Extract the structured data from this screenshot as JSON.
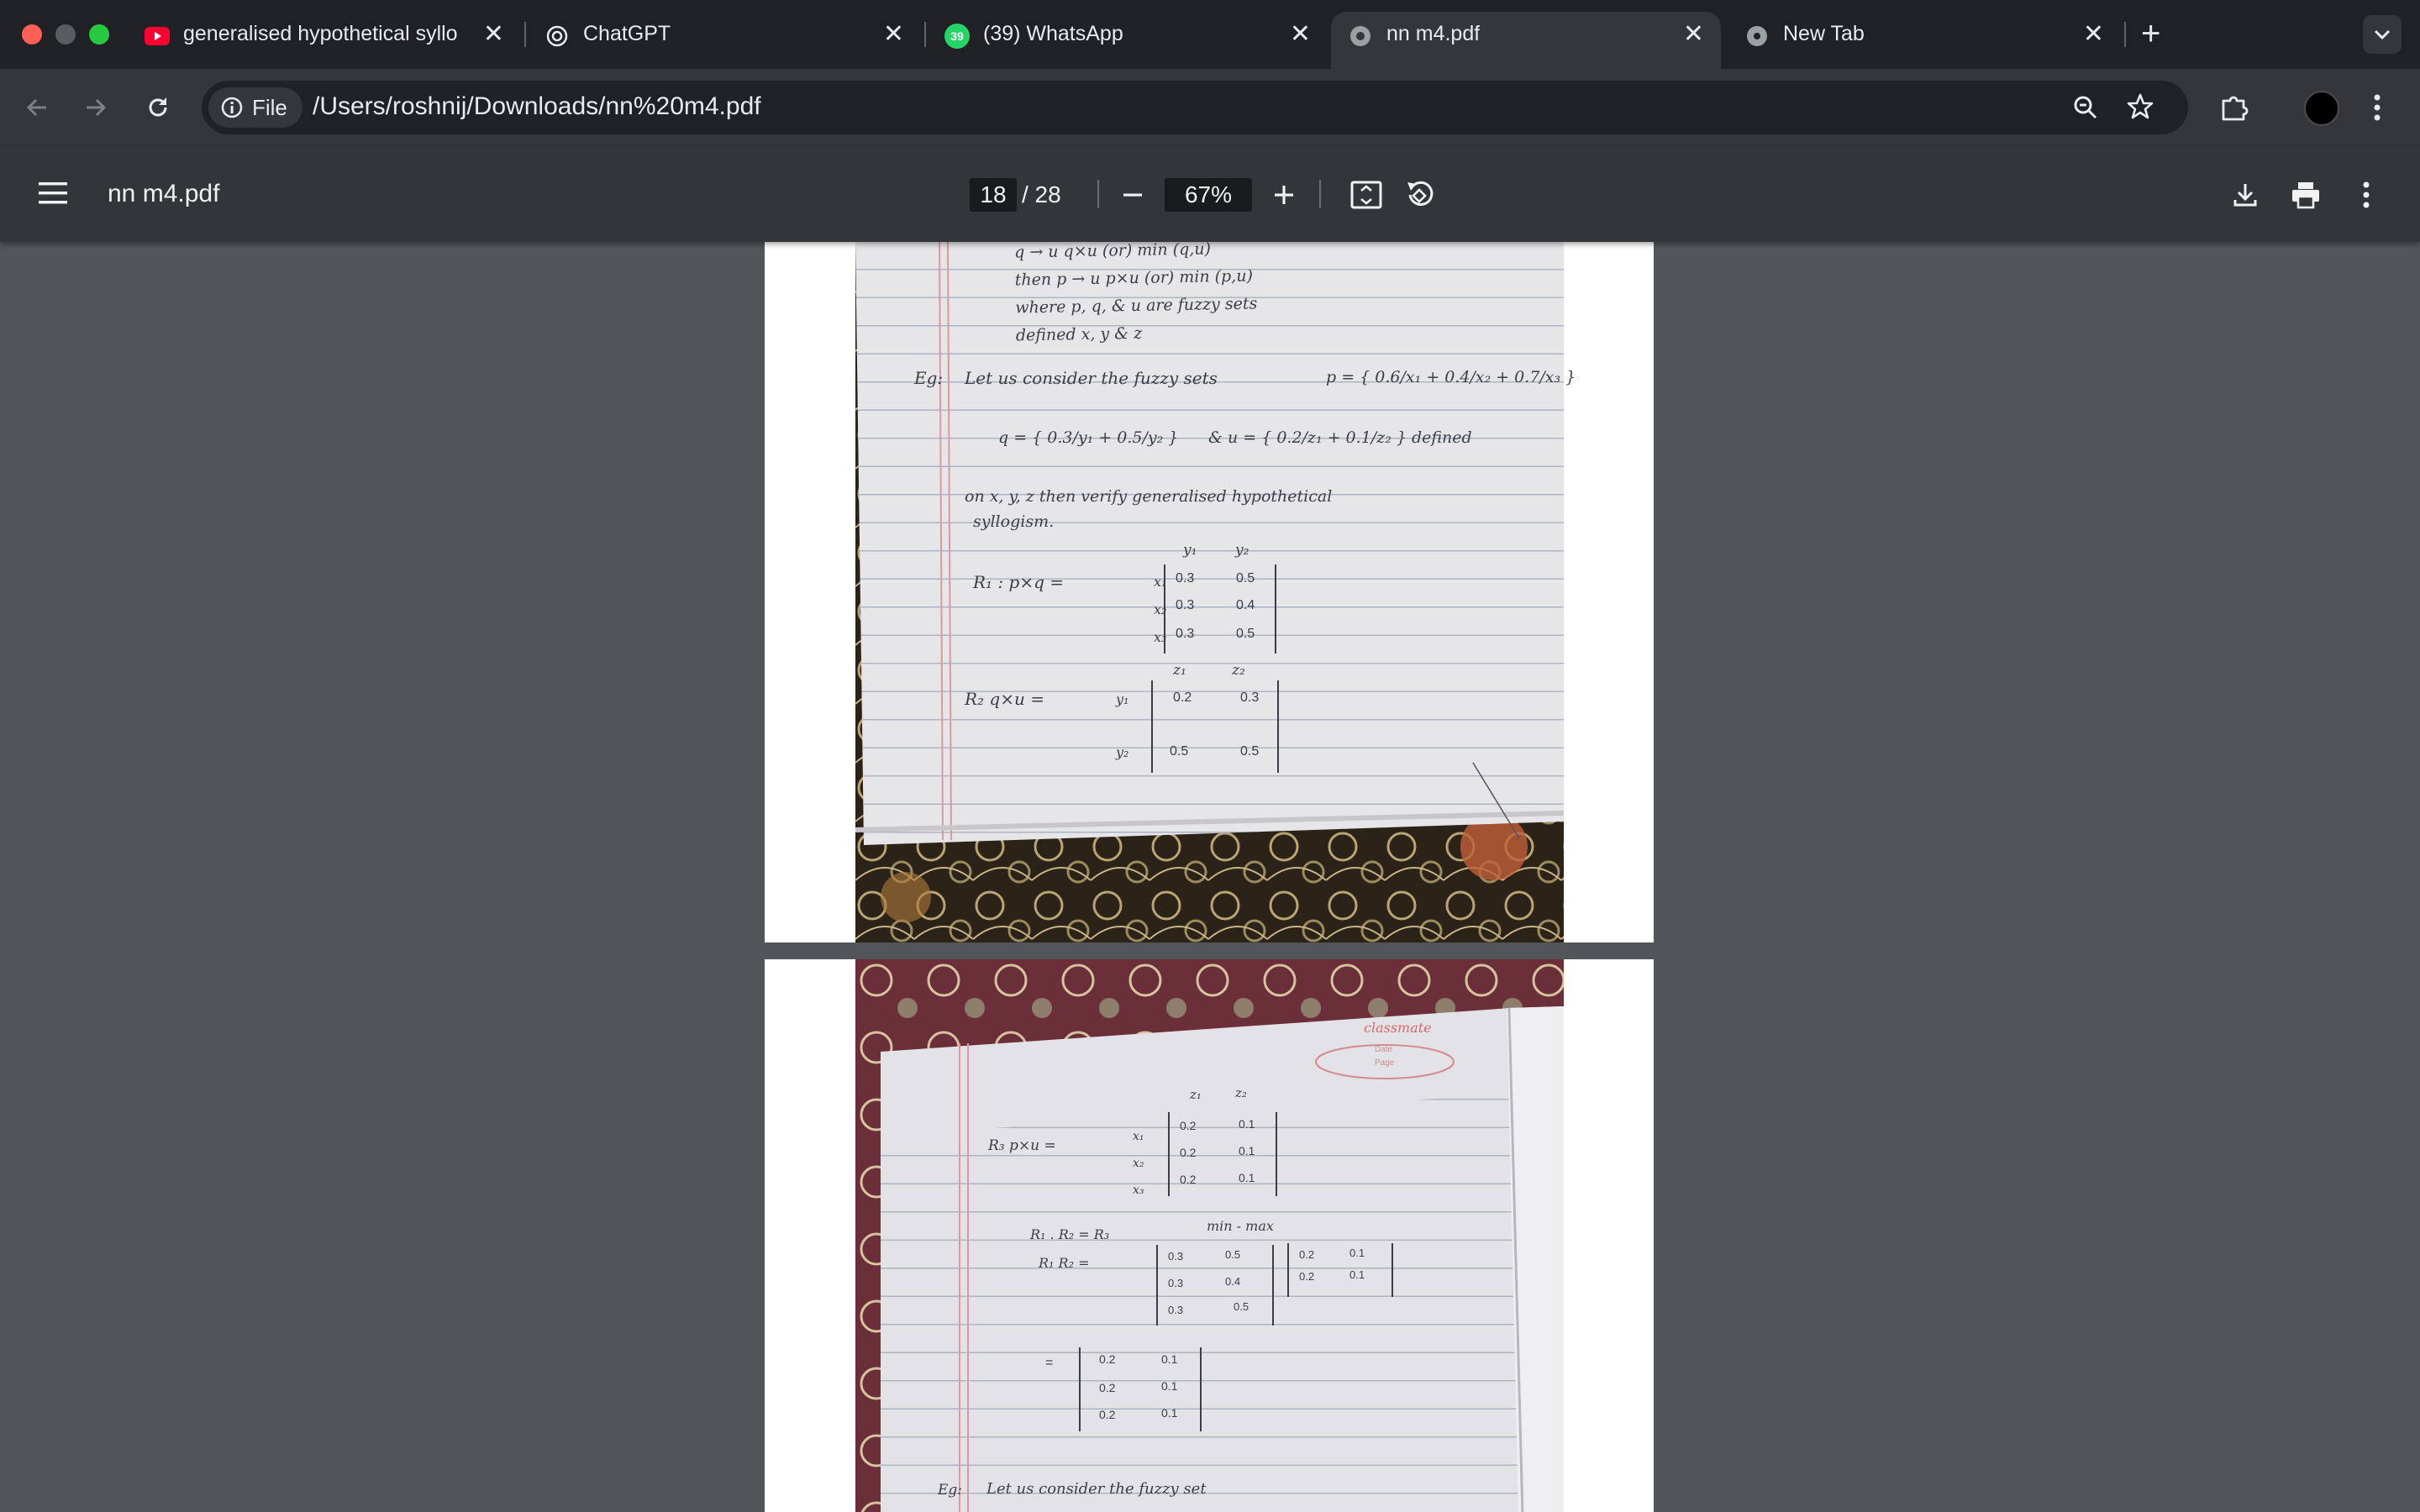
{
  "browser": {
    "tabs": [
      {
        "title": "generalised hypothetical syllo",
        "icon": "youtube-icon",
        "active": false
      },
      {
        "title": "ChatGPT",
        "icon": "chatgpt-icon",
        "active": false
      },
      {
        "title": "(39) WhatsApp",
        "icon": "whatsapp-icon",
        "badge": "39",
        "active": false
      },
      {
        "title": "nn m4.pdf",
        "icon": "globe-icon",
        "active": true
      },
      {
        "title": "New Tab",
        "icon": "chrome-icon",
        "active": false
      }
    ],
    "new_tab_label": "+",
    "address": {
      "chip_label": "File",
      "url": "/Users/roshnij/Downloads/nn%20m4.pdf"
    }
  },
  "pdf_viewer": {
    "title": "nn m4.pdf",
    "current_page": "18",
    "total_pages": "/ 28",
    "zoom": "67%"
  },
  "page_a_notes": {
    "lines": [
      "q → u  q×u (or) min (q,u)",
      "then p → u  p×u (or) min (p,u)",
      "where p, q, & u are fuzzy sets",
      "defined x, y & z"
    ],
    "example_intro": "Let us consider the fuzzy sets",
    "eg": "Eg:",
    "p_def": "p = { 0.6/x₁ + 0.4/x₂ + 0.7/x₃ }",
    "q_def": "q = { 0.3/y₁ + 0.5/y₂ }",
    "u_def": "& u = { 0.2/z₁ + 0.1/z₂ } defined",
    "verify": "on x, y, z then verify generalised hypothetical",
    "syllogism": "syllogism.",
    "r1_label": "R₁ : p×q =",
    "r2_label": "R₂  q×u =",
    "r1_cols": [
      "y₁",
      "y₂"
    ],
    "r1_rows": [
      {
        "label": "x₁",
        "cells": [
          "0.3",
          "0.5"
        ]
      },
      {
        "label": "x₂",
        "cells": [
          "0.3",
          "0.4"
        ]
      },
      {
        "label": "x₃",
        "cells": [
          "0.3",
          "0.5"
        ]
      }
    ],
    "r2_cols": [
      "z₁",
      "z₂"
    ],
    "r2_rows": [
      {
        "label": "y₁",
        "cells": [
          "0.2",
          "0.3"
        ]
      },
      {
        "label": "y₂",
        "cells": [
          "0.5",
          "0.5"
        ]
      }
    ]
  },
  "page_b_notes": {
    "brand": "classmate",
    "date_label": "Date",
    "page_label": "Page",
    "r3_label": "R₃  p×u =",
    "r3_cols": [
      "z₁",
      "z₂"
    ],
    "r3_rows": [
      {
        "label": "x₁",
        "cells": [
          "0.2",
          "0.1"
        ]
      },
      {
        "label": "x₂",
        "cells": [
          "0.2",
          "0.1"
        ]
      },
      {
        "label": "x₃",
        "cells": [
          "0.2",
          "0.1"
        ]
      }
    ],
    "compose_line": "R₁ . R₂ = R₃",
    "method": "min - max",
    "compose_eq": "R₁ R₂ =",
    "m1_rows": [
      [
        "0.3",
        "0.5"
      ],
      [
        "0.3",
        "0.4"
      ],
      [
        "0.3",
        "0.5"
      ]
    ],
    "m2_rows": [
      [
        "0.2",
        "0.1"
      ],
      [
        "0.2",
        "0.1"
      ]
    ],
    "result_eq": "=",
    "result_rows": [
      [
        "0.2",
        "0.1"
      ],
      [
        "0.2",
        "0.1"
      ],
      [
        "0.2",
        "0.1"
      ]
    ],
    "eg2": "Eg:",
    "next_line": "Let us consider the fuzzy set"
  }
}
